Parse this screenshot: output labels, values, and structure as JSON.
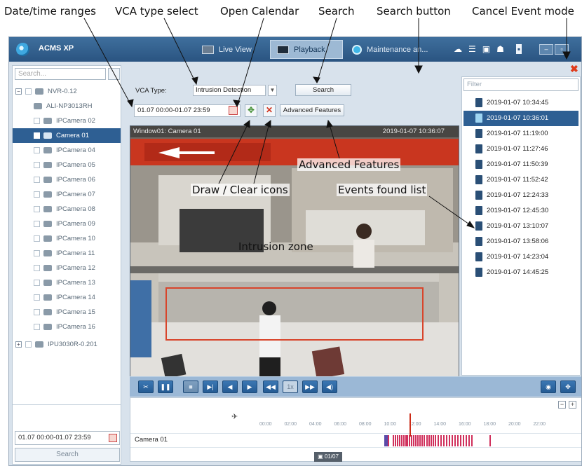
{
  "annotations": {
    "date_time_ranges": "Date/time ranges",
    "vca_type_select": "VCA type select",
    "open_calendar": "Open Calendar",
    "search": "Search",
    "search_button": "Search button",
    "cancel_event_mode": "Cancel Event mode",
    "advanced_features": "Advanced Features",
    "draw_clear_icons": "Draw / Clear icons",
    "events_found_list": "Events found list",
    "intrusion_zone": "Intrusion zone"
  },
  "app": {
    "title": "ACMS XP",
    "tabs": [
      {
        "label": "Live View",
        "icon": "live-view-icon"
      },
      {
        "label": "Playback",
        "icon": "playback-icon"
      },
      {
        "label": "Maintenance an...",
        "icon": "gear-icon"
      }
    ]
  },
  "left_panel": {
    "search_placeholder": "Search...",
    "tree": [
      {
        "label": "NVR-0.12",
        "icon": "nvr-icon"
      },
      {
        "label": "ALI-NP3013RH",
        "icon": "camera-icon"
      },
      {
        "label": "IPCamera 02",
        "icon": "camera-icon"
      },
      {
        "label": "Camera 01",
        "icon": "camera-icon"
      },
      {
        "label": "IPCamera 04",
        "icon": "camera-icon"
      },
      {
        "label": "IPCamera 05",
        "icon": "camera-icon"
      },
      {
        "label": "IPCamera 06",
        "icon": "camera-icon"
      },
      {
        "label": "IPCamera 07",
        "icon": "camera-icon"
      },
      {
        "label": "IPCamera 08",
        "icon": "camera-icon"
      },
      {
        "label": "IPCamera 09",
        "icon": "camera-icon"
      },
      {
        "label": "IPCamera 10",
        "icon": "camera-icon"
      },
      {
        "label": "IPCamera 11",
        "icon": "camera-icon"
      },
      {
        "label": "IPCamera 12",
        "icon": "camera-icon"
      },
      {
        "label": "IPCamera 13",
        "icon": "camera-icon"
      },
      {
        "label": "IPCamera 14",
        "icon": "camera-icon"
      },
      {
        "label": "IPCamera 15",
        "icon": "camera-icon"
      },
      {
        "label": "IPCamera 16",
        "icon": "camera-icon"
      },
      {
        "label": "IPU3030R-0.201",
        "icon": "nvr-icon"
      }
    ],
    "date_range": "01.07 00:00-01.07 23:59",
    "search_label": "Search"
  },
  "vca": {
    "type_label": "VCA Type:",
    "type_value": "Intrusion Detection",
    "search_label": "Search",
    "range_value": "01.07 00:00-01.07 23:59",
    "advanced_label": "Advanced Features"
  },
  "video": {
    "window_title": "Window01: Camera 01",
    "timestamp": "2019-01-07 10:36:07"
  },
  "timeline": {
    "ticks": [
      "00:00",
      "02:00",
      "04:00",
      "06:00",
      "08:00",
      "10:00",
      "12:00",
      "14:00",
      "16:00",
      "18:00",
      "20:00",
      "22:00"
    ],
    "row_label": "Camera 01",
    "date_label": "01/07",
    "speed": "1x"
  },
  "events": {
    "filter_placeholder": "Filter",
    "items": [
      "2019-01-07 10:34:45",
      "2019-01-07 10:36:01",
      "2019-01-07 11:19:00",
      "2019-01-07 11:27:46",
      "2019-01-07 11:50:39",
      "2019-01-07 11:52:42",
      "2019-01-07 12:24:33",
      "2019-01-07 12:45:30",
      "2019-01-07 13:10:07",
      "2019-01-07 13:58:06",
      "2019-01-07 14:23:04",
      "2019-01-07 14:45:25"
    ]
  },
  "colors": {
    "title_bar": "#2a5481",
    "selection": "#2e5f93",
    "zone_outline": "#d8452b",
    "event_bars": "#d0305c"
  }
}
